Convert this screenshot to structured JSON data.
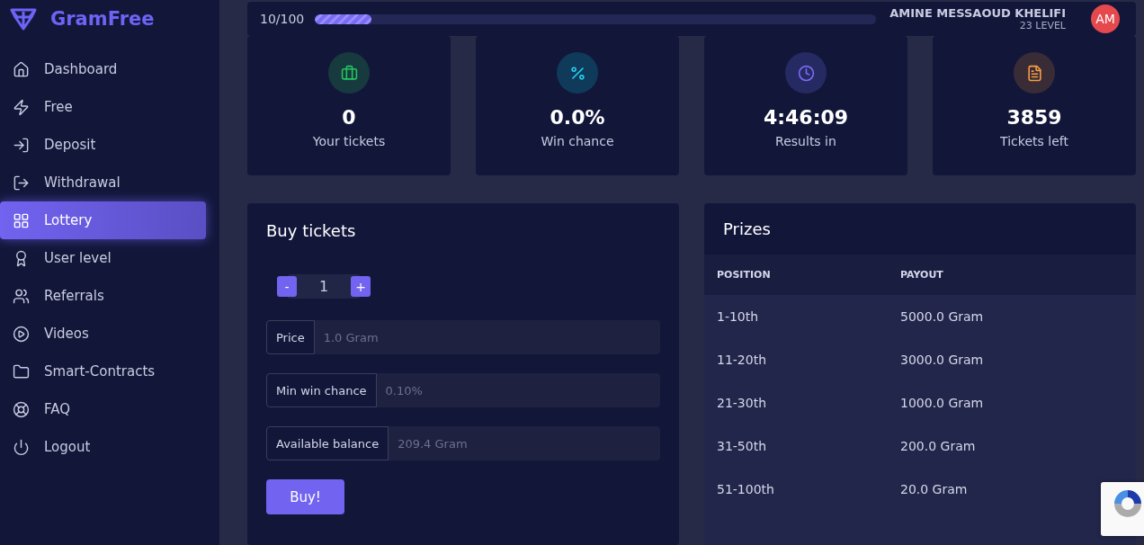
{
  "brand": {
    "name": "GramFree"
  },
  "sidebar": {
    "items": [
      {
        "label": "Dashboard",
        "selected": false
      },
      {
        "label": "Free",
        "selected": false
      },
      {
        "label": "Deposit",
        "selected": false
      },
      {
        "label": "Withdrawal",
        "selected": false
      },
      {
        "label": "Lottery",
        "selected": true
      },
      {
        "label": "User level",
        "selected": false
      },
      {
        "label": "Referrals",
        "selected": false
      },
      {
        "label": "Videos",
        "selected": false
      },
      {
        "label": "Smart-Contracts",
        "selected": false
      },
      {
        "label": "FAQ",
        "selected": false
      },
      {
        "label": "Logout",
        "selected": false
      }
    ]
  },
  "topbar": {
    "progress_text": "10/100",
    "level": 0.1,
    "user_name": "AMINE MESSAOUD KHELIFI",
    "user_level": "23 LEVEL",
    "avatar": "AM"
  },
  "stats": [
    {
      "value": "0",
      "label": "Your tickets"
    },
    {
      "value": "0.0%",
      "label": "Win chance"
    },
    {
      "value": "4:46:09",
      "label": "Results in"
    },
    {
      "value": "3859",
      "label": "Tickets left"
    }
  ],
  "buy_tickets": {
    "title": "Buy tickets",
    "minus": "-",
    "quantity": "1",
    "plus": "+",
    "fields": [
      {
        "label": "Price",
        "value": "1.0 Gram"
      },
      {
        "label": "Min win chance",
        "value": "0.10%"
      },
      {
        "label": "Available balance",
        "value": "209.4 Gram"
      }
    ],
    "button": "Buy!"
  },
  "prizes": {
    "title": "Prizes",
    "columns": [
      "POSITION",
      "PAYOUT"
    ],
    "rows": [
      [
        "1-10th",
        "5000.0 Gram"
      ],
      [
        "11-20th",
        "3000.0 Gram"
      ],
      [
        "21-30th",
        "1000.0 Gram"
      ],
      [
        "31-50th",
        "200.0 Gram"
      ],
      [
        "51-100th",
        "20.0 Gram"
      ]
    ]
  }
}
